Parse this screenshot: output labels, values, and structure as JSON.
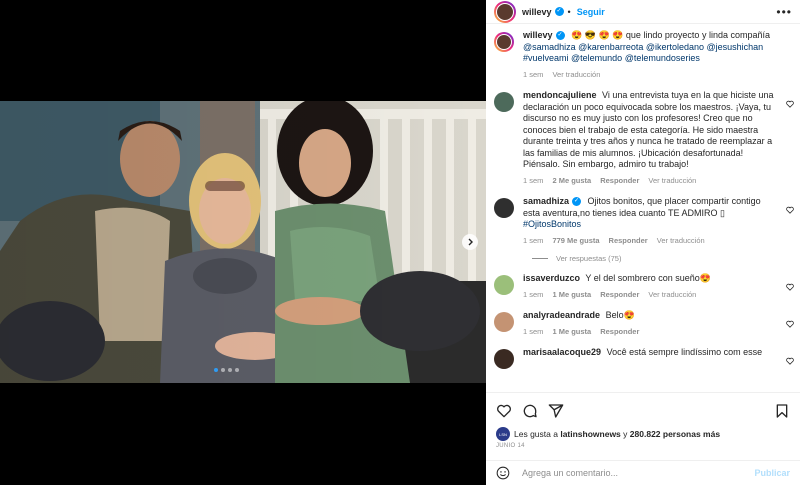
{
  "post": {
    "username": "willevy",
    "follow_label": "Seguir",
    "separator": "•",
    "more_label": "•••"
  },
  "media": {
    "slide_count": 4,
    "active_slide": 1
  },
  "caption": {
    "username": "willevy",
    "emojis": "😍 😎 😍 😍",
    "text": "que lindo proyecto y linda compañía",
    "mentions": "@samadhiza @karenbarreota @ikertoledano @jesushichan #vuelveami @telemundo @telemundoseries",
    "time": "1 sem",
    "translate": "Ver traducción"
  },
  "comments": [
    {
      "username": "mendoncajuliene",
      "text": "Vi una entrevista tuya en la que hiciste una declaración un poco equivocada sobre los maestros. ¡Vaya, tu discurso no es muy justo con los profesores! Creo que no conoces bien el trabajo de esta categoría. He sido maestra durante treinta y tres años y nunca he tratado de reemplazar a las familias de mis alumnos. ¡Ubicación desafortunada! Piénsalo. Sin embargo, admiro tu trabajo!",
      "time": "1 sem",
      "likes": "2 Me gusta",
      "reply": "Responder",
      "translate": "Ver traducción"
    },
    {
      "username": "samadhiza",
      "text": "Ojitos bonitos, que placer compartir contigo esta aventura,no tienes idea cuanto TE ADMIRO ▯",
      "hashtag": "#OjitosBonitos",
      "time": "1 sem",
      "likes": "779 Me gusta",
      "reply": "Responder",
      "translate": "Ver traducción",
      "view_replies": "Ver respuestas (75)"
    },
    {
      "username": "issaverduzco",
      "text": "Y el del sombrero con sueño😍",
      "time": "1 sem",
      "likes": "1 Me gusta",
      "reply": "Responder",
      "translate": "Ver traducción"
    },
    {
      "username": "analyradeandrade",
      "text": "Belo😍",
      "time": "1 sem",
      "likes": "1 Me gusta",
      "reply": "Responder"
    },
    {
      "username": "marisaalacoque29",
      "text": "Você está sempre lindíssimo com esse"
    }
  ],
  "likes": {
    "prefix": "Les gusta a",
    "user": "latinshownews",
    "joiner": "y",
    "others": "280.822 personas más",
    "avatar_text": "LSN"
  },
  "date": "JUNIO 14",
  "comment_box": {
    "placeholder": "Agrega un comentario...",
    "publish": "Publicar"
  },
  "colors": {
    "accent": "#0095f6",
    "publish_disabled": "#b2dffc",
    "link": "#00376b",
    "muted": "#8e8e8e"
  },
  "icons": [
    "verified-badge-icon",
    "more-options-icon",
    "heart-icon",
    "comment-icon",
    "share-icon",
    "bookmark-icon",
    "emoji-icon",
    "next-arrow-icon"
  ]
}
